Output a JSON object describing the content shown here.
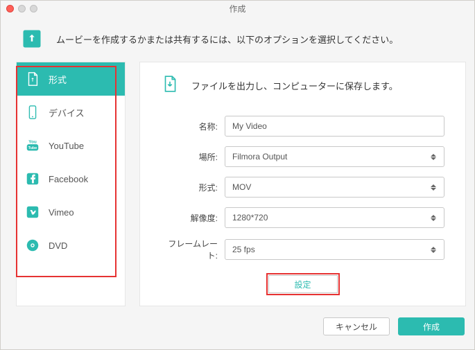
{
  "window": {
    "title": "作成"
  },
  "banner": {
    "text": "ムービーを作成するかまたは共有するには、以下のオプションを選択してください。"
  },
  "sidebar": {
    "items": [
      {
        "label": "形式"
      },
      {
        "label": "デバイス"
      },
      {
        "label": "YouTube"
      },
      {
        "label": "Facebook"
      },
      {
        "label": "Vimeo"
      },
      {
        "label": "DVD"
      }
    ]
  },
  "main": {
    "heading": "ファイルを出力し、コンピューターに保存します。",
    "labels": {
      "name": "名称:",
      "location": "場所:",
      "format": "形式:",
      "resolution": "解像度:",
      "framerate": "フレームレート:"
    },
    "values": {
      "name": "My Video",
      "location": "Filmora Output",
      "format": "MOV",
      "resolution": "1280*720",
      "framerate": "25 fps"
    },
    "settings_btn": "設定"
  },
  "footer": {
    "cancel": "キャンセル",
    "create": "作成"
  }
}
